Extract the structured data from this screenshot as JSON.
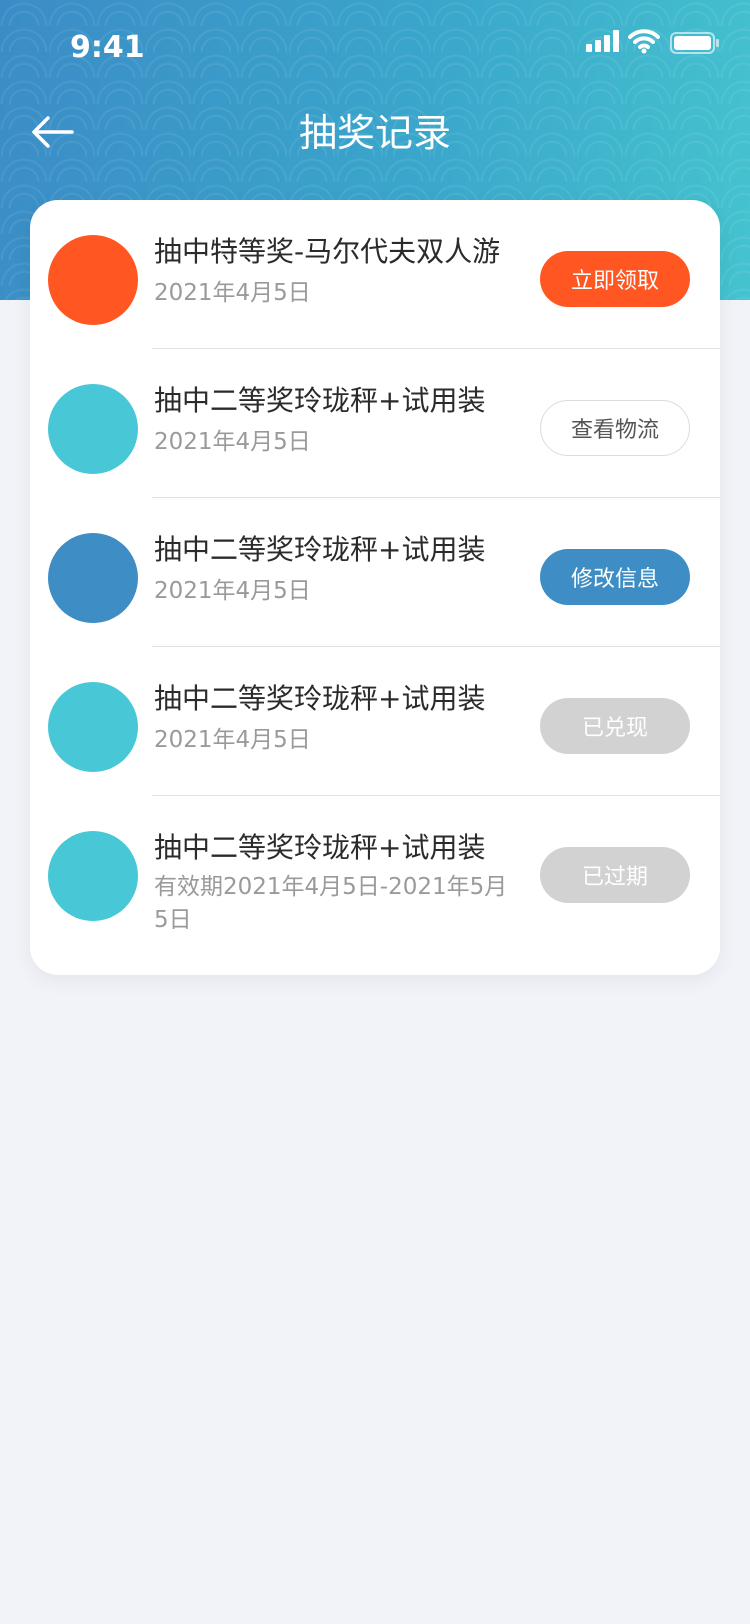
{
  "status_bar": {
    "time": "9:41"
  },
  "nav": {
    "title": "抽奖记录",
    "back_icon": "arrow-left-icon"
  },
  "colors": {
    "orange": "#ff5622",
    "teal": "#48c8d6",
    "blue": "#3e8ec5",
    "gray_btn": "#d2d2d2"
  },
  "records": [
    {
      "title": "抽中特等奖-马尔代夫双人游",
      "date": "2021年4月5日",
      "action": "立即领取",
      "avatar_color": "#ff5622"
    },
    {
      "title": "抽中二等奖玲珑秤+试用装",
      "date": "2021年4月5日",
      "action": "查看物流",
      "avatar_color": "#48c8d6"
    },
    {
      "title": "抽中二等奖玲珑秤+试用装",
      "date": "2021年4月5日",
      "action": "修改信息",
      "avatar_color": "#3e8ec5"
    },
    {
      "title": "抽中二等奖玲珑秤+试用装",
      "date": "2021年4月5日",
      "action": "已兑现",
      "avatar_color": "#48c8d6"
    },
    {
      "title": "抽中二等奖玲珑秤+试用装",
      "date": "有效期2021年4月5日-2021年5月5日",
      "action": "已过期",
      "avatar_color": "#48c8d6"
    }
  ]
}
